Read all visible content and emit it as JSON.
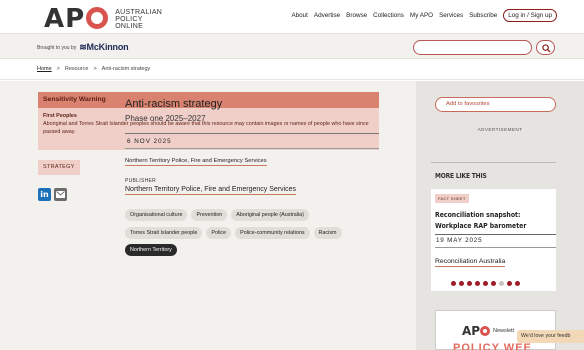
{
  "header": {
    "logo_letters": "APO",
    "logo_lines": [
      "AUSTRALIAN",
      "POLICY",
      "ONLINE"
    ],
    "nav": [
      "About",
      "Advertise",
      "Browse",
      "Collections",
      "My APO",
      "Services",
      "Subscribe"
    ],
    "login_label": "Log in / Sign up"
  },
  "subbar": {
    "brought_label": "Brought to you by",
    "sponsor": "McKinnon",
    "search_placeholder": ""
  },
  "breadcrumb": [
    "Home",
    ">",
    "Resource",
    ">",
    "Anti-racism strategy"
  ],
  "warning": {
    "heading": "Sensitivity Warning",
    "title": "First Peoples",
    "body": "Aboriginal and Torres Strait Islander peoples should be aware that this resource may contain images or names of people who have since passed away."
  },
  "resource": {
    "type_tag": "STRATEGY",
    "title": "Anti-racism strategy",
    "subtitle": "Phase one 2025–2027",
    "date": "6 NOV 2025",
    "author": "Northern Territory Police, Fire and Emergency Services",
    "publisher_label": "PUBLISHER",
    "publisher": "Northern Territory Police, Fire and Emergency Services",
    "tags_row1": [
      "Organisational culture",
      "Prevention",
      "Aboriginal people (Australia)"
    ],
    "tags_row2": [
      "Torres Strait Islander people",
      "Police",
      "Police-community relations",
      "Racism"
    ],
    "tags_row3": [
      "Northern Territory"
    ]
  },
  "sidebar": {
    "favourites_label": "Add to favourites",
    "advertisement_label": "ADVERTISEMENT",
    "more_like_this": "MORE LIKE THIS",
    "card": {
      "tag": "FACT SHEET",
      "title": "Reconciliation snapshot: Workplace RAP barometer",
      "date": "19 MAY 2025",
      "author": "Reconciliation Australia"
    },
    "carousel": {
      "count": 9,
      "inactive_index": 6
    },
    "newsletter": {
      "logo_letters": "APO",
      "label": "Newslett",
      "banner": "POLICY WEE"
    },
    "feedback_label": "We'd love your feedb"
  },
  "colors": {
    "accent": "#d9534f",
    "warning_bg": "#f0cfc8",
    "warning_head": "#d9826f",
    "carousel_active": "#9e1c2a"
  },
  "icons": [
    "linkedin-icon",
    "email-icon",
    "search-icon"
  ]
}
